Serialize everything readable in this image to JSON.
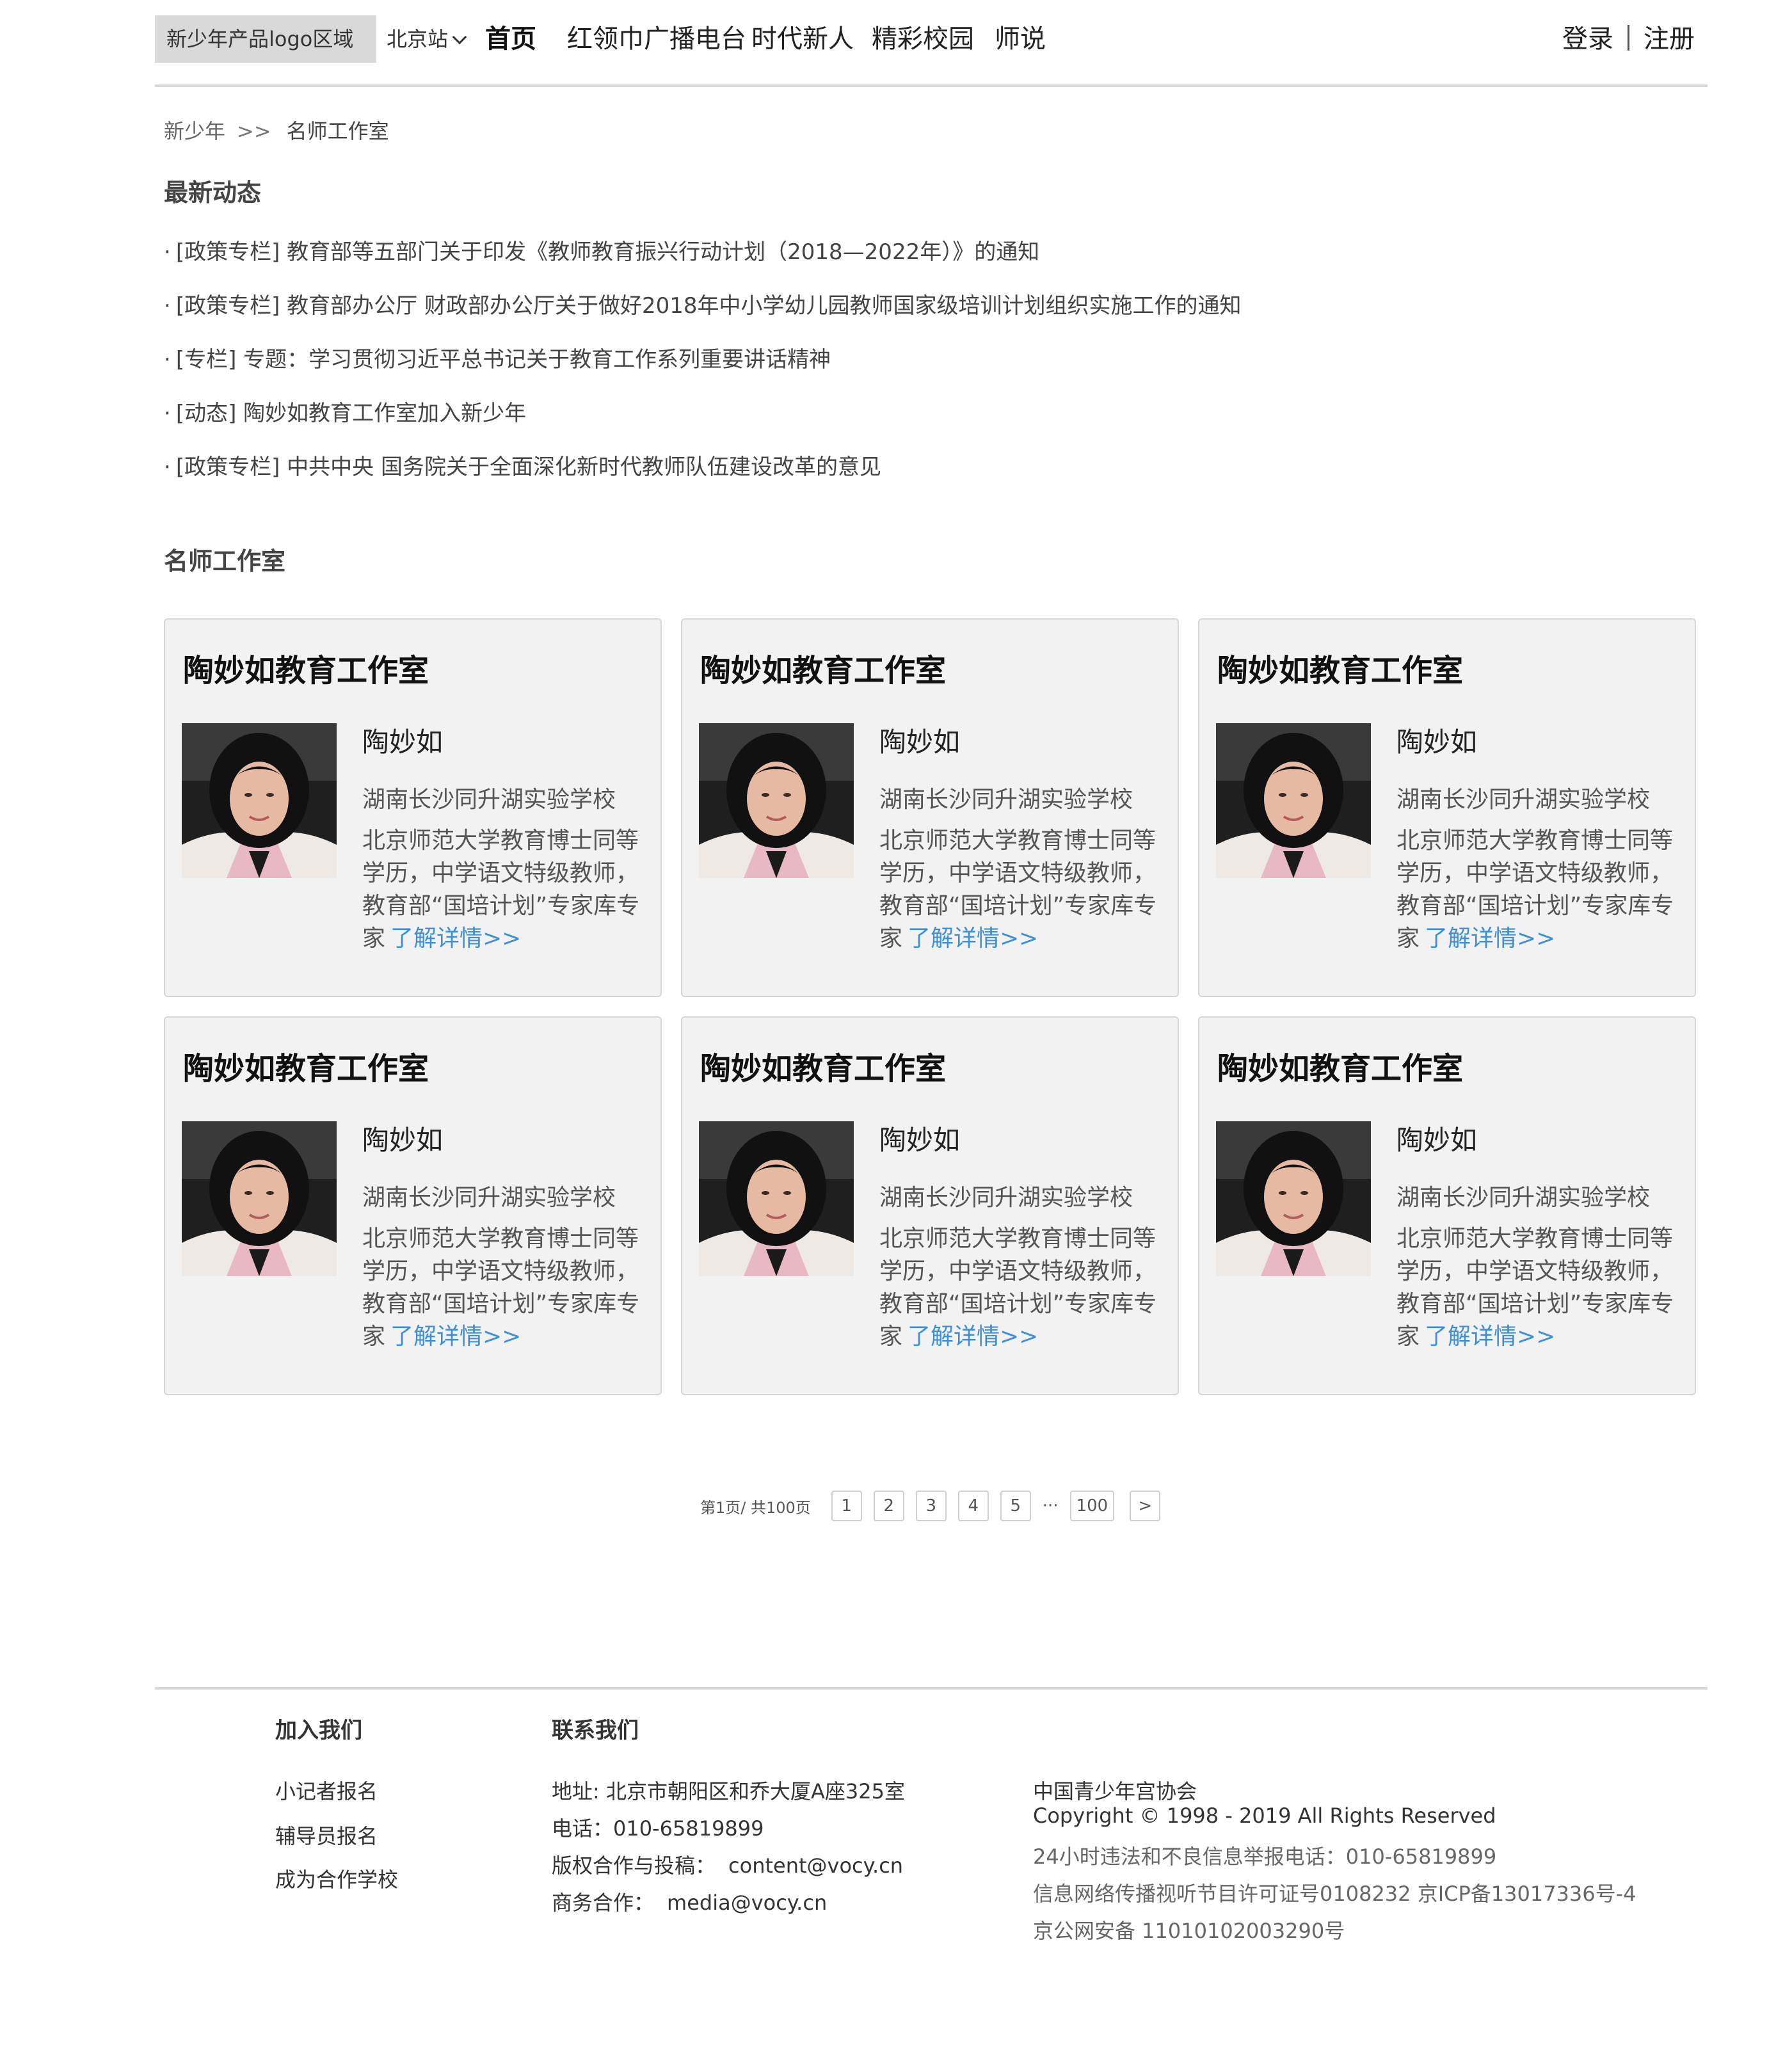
{
  "header": {
    "logo_text": "新少年产品logo区域",
    "city": "北京站",
    "nav": [
      "首页",
      "红领巾广播电台",
      "时代新人",
      "精彩校园",
      "师说"
    ],
    "login": "登录",
    "register": "注册"
  },
  "breadcrumb": {
    "root": "新少年",
    "separator": ">>",
    "current": "名师工作室"
  },
  "latest": {
    "title": "最新动态",
    "items": [
      "[政策专栏] 教育部等五部门关于印发《教师教育振兴行动计划（2018—2022年）》的通知",
      "[政策专栏] 教育部办公厅 财政部办公厅关于做好2018年中小学幼儿园教师国家级培训计划组织实施工作的通知",
      "[专栏] 专题：学习贯彻习近平总书记关于教育工作系列重要讲话精神",
      "[动态] 陶妙如教育工作室加入新少年",
      "[政策专栏] 中共中央 国务院关于全面深化新时代教师队伍建设改革的意见"
    ]
  },
  "studios": {
    "title": "名师工作室",
    "cards": [
      {
        "title": "陶妙如教育工作室",
        "name": "陶妙如",
        "school": "湖南长沙同升湖实验学校",
        "desc": "北京师范大学教育博士同等学历，中学语文特级教师，教育部“国培计划”专家库专家",
        "more": "了解详情>>"
      },
      {
        "title": "陶妙如教育工作室",
        "name": "陶妙如",
        "school": "湖南长沙同升湖实验学校",
        "desc": "北京师范大学教育博士同等学历，中学语文特级教师，教育部“国培计划”专家库专家",
        "more": "了解详情>>"
      },
      {
        "title": "陶妙如教育工作室",
        "name": "陶妙如",
        "school": "湖南长沙同升湖实验学校",
        "desc": "北京师范大学教育博士同等学历，中学语文特级教师，教育部“国培计划”专家库专家",
        "more": "了解详情>>"
      },
      {
        "title": "陶妙如教育工作室",
        "name": "陶妙如",
        "school": "湖南长沙同升湖实验学校",
        "desc": "北京师范大学教育博士同等学历，中学语文特级教师，教育部“国培计划”专家库专家",
        "more": "了解详情>>"
      },
      {
        "title": "陶妙如教育工作室",
        "name": "陶妙如",
        "school": "湖南长沙同升湖实验学校",
        "desc": "北京师范大学教育博士同等学历，中学语文特级教师，教育部“国培计划”专家库专家",
        "more": "了解详情>>"
      },
      {
        "title": "陶妙如教育工作室",
        "name": "陶妙如",
        "school": "湖南长沙同升湖实验学校",
        "desc": "北京师范大学教育博士同等学历，中学语文特级教师，教育部“国培计划”专家库专家",
        "more": "了解详情>>"
      }
    ]
  },
  "pagination": {
    "info": "第1页/ 共100页",
    "pages": [
      "1",
      "2",
      "3",
      "4",
      "5"
    ],
    "ellipsis": "···",
    "last": "100",
    "next": ">"
  },
  "footer": {
    "join_title": "加入我们",
    "join_links": [
      "小记者报名",
      "辅导员报名",
      "成为合作学校"
    ],
    "contact_title": "联系我们",
    "address": "地址: 北京市朝阳区和乔大厦A座325室",
    "phone": "电话：010-65819899",
    "copyright_label": "版权合作与投稿：",
    "copyright_email": "content@vocy.cn",
    "business_label": "商务合作：",
    "business_email": "media@vocy.cn",
    "org": "中国青少年宫协会",
    "copyright": "Copyright © 1998 - 2019 All Rights Reserved",
    "report": "24小时违法和不良信息举报电话：010-65819899",
    "license": "信息网络传播视听节目许可证号0108232 京ICP备13017336号-4",
    "police": "京公网安备 11010102003290号"
  },
  "colors": {
    "link": "#3d8fd9",
    "card_bg": "#f2f2f2",
    "logo_bg": "#d9d9d9"
  }
}
